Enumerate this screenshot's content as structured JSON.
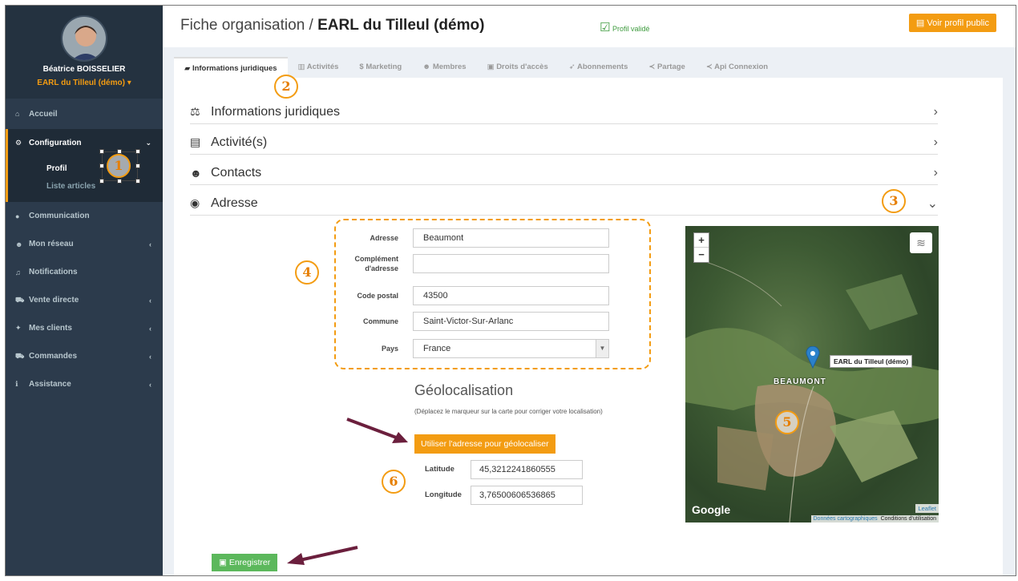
{
  "user": {
    "name": "Béatrice BOISSELIER",
    "org": "EARL du Tilleul (démo) ▾"
  },
  "sidebar": {
    "items": [
      {
        "label": "Accueil",
        "icon": "home-icon"
      },
      {
        "label": "Configuration",
        "icon": "cogs-icon"
      },
      {
        "label": "Communication",
        "icon": "comments-icon"
      },
      {
        "label": "Mon réseau",
        "icon": "users-icon"
      },
      {
        "label": "Notifications",
        "icon": "bell-icon"
      },
      {
        "label": "Vente directe",
        "icon": "cart-icon"
      },
      {
        "label": "Mes clients",
        "icon": "handshake-icon"
      },
      {
        "label": "Commandes",
        "icon": "cart-icon"
      },
      {
        "label": "Assistance",
        "icon": "info-icon"
      }
    ],
    "sub_items": [
      "Profil",
      "Liste articles"
    ]
  },
  "header": {
    "title_prefix": "Fiche organisation / ",
    "title_org": "EARL du Tilleul (démo)",
    "status": "Profil validé",
    "public_button": "Voir profil public"
  },
  "tabs": [
    "Informations juridiques",
    "Activités",
    "Marketing",
    "Membres",
    "Droits d'accès",
    "Abonnements",
    "Partage",
    "Api Connexion"
  ],
  "sections": [
    "Informations juridiques",
    "Activité(s)",
    "Contacts",
    "Adresse"
  ],
  "address": {
    "labels": {
      "adresse": "Adresse",
      "complement": "Complément d'adresse",
      "cp": "Code postal",
      "commune": "Commune",
      "pays": "Pays"
    },
    "values": {
      "adresse": "Beaumont",
      "complement": "",
      "cp": "43500",
      "commune": "Saint-Victor-Sur-Arlanc",
      "pays": "France"
    }
  },
  "geo": {
    "title": "Géolocalisation",
    "help": "(Déplacez le marqueur sur la carte pour corriger votre localisation)",
    "button": "Utiliser l'adresse pour géolocaliser",
    "lat_label": "Latitude",
    "lat": "45,3212241860555",
    "lon_label": "Longitude",
    "lon": "3,76500606536865"
  },
  "map": {
    "marker_label": "EARL du Tilleul (démo)",
    "town": "BEAUMONT",
    "brand": "Google",
    "data_link": "Données cartographiques",
    "terms": "Conditions d'utilisation",
    "leaflet": "Leaflet",
    "zoom_in": "+",
    "zoom_out": "−"
  },
  "save_button": "Enregistrer",
  "annotations": [
    "1",
    "2",
    "3",
    "4",
    "5",
    "6"
  ],
  "colors": {
    "accent": "#f39c12",
    "sidebar": "#2c3b4c",
    "save": "#5cb85c"
  }
}
